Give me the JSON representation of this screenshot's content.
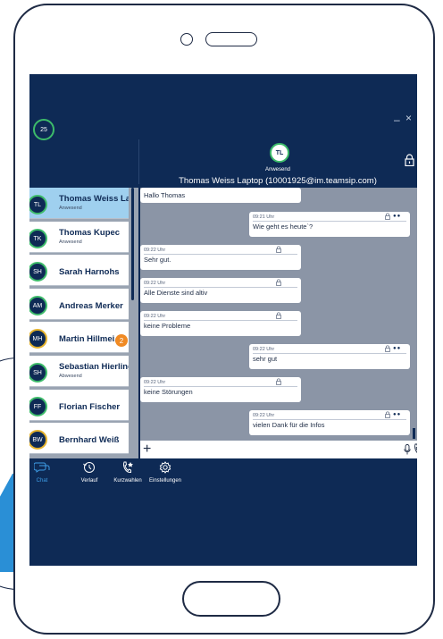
{
  "app": {
    "logo_text": "25"
  },
  "window": {
    "minimize": "–",
    "close": "×"
  },
  "chat_header": {
    "avatar_initials": "TL",
    "status": "Anwesend",
    "name": "Thomas Weiss Laptop (10001925@im.teamsip.com)"
  },
  "contacts": [
    {
      "initials": "TL",
      "name": "Thomas Weiss Lap...",
      "status": "Anwesend",
      "presence": "online",
      "active": true
    },
    {
      "initials": "TK",
      "name": "Thomas Kupec",
      "status": "Anwesend",
      "presence": "online"
    },
    {
      "initials": "SH",
      "name": "Sarah Harnohs",
      "status": "",
      "presence": "online"
    },
    {
      "initials": "AM",
      "name": "Andreas Merker",
      "status": "",
      "presence": "online"
    },
    {
      "initials": "MH",
      "name": "Martin Hillmei...",
      "status": "",
      "presence": "away",
      "badge": "2"
    },
    {
      "initials": "SH",
      "name": "Sebastian Hierling",
      "status": "Abwesend",
      "presence": "online"
    },
    {
      "initials": "FF",
      "name": "Florian Fischer",
      "status": "",
      "presence": "online"
    },
    {
      "initials": "BW",
      "name": "Bernhard Weiß",
      "status": "",
      "presence": "away"
    }
  ],
  "messages": [
    {
      "side": "left",
      "time": "",
      "text": "Hallo Thomas"
    },
    {
      "side": "right",
      "time": "09:21 Uhr",
      "text": "Wie geht es heute`?"
    },
    {
      "side": "left",
      "time": "09:22 Uhr",
      "text": "Sehr gut."
    },
    {
      "side": "left",
      "time": "09:22 Uhr",
      "text": "Alle Dienste sind altiv"
    },
    {
      "side": "left",
      "time": "09:22 Uhr",
      "text": "keine Probleme"
    },
    {
      "side": "right",
      "time": "09:22 Uhr",
      "text": "sehr gut"
    },
    {
      "side": "left",
      "time": "09:22 Uhr",
      "text": "keine Störungen"
    },
    {
      "side": "right",
      "time": "09:22 Uhr",
      "text": "vielen Dank für die Infos"
    }
  ],
  "input": {
    "add_label": "+"
  },
  "nav": [
    {
      "label": "Chat",
      "icon": "chat-icon",
      "active": true
    },
    {
      "label": "Verlauf",
      "icon": "history-icon"
    },
    {
      "label": "Kurzwahlen",
      "icon": "speed-dial-icon"
    },
    {
      "label": "Einstellungen",
      "icon": "settings-icon"
    }
  ],
  "colors": {
    "screen_bg": "#0e2a55",
    "accent": "#3e9ee8",
    "online": "#3dbb6a",
    "away": "#e3b12b",
    "badge": "#f08a24",
    "active_contact": "#9fd0ef"
  }
}
